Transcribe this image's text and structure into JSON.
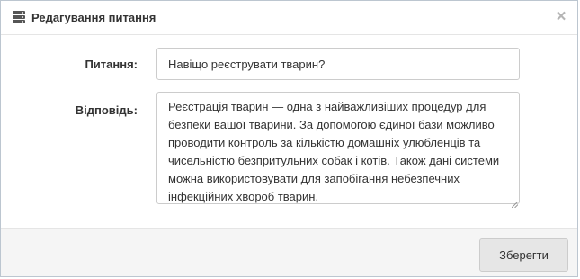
{
  "dialog": {
    "title": "Редагування питання",
    "title_icon": "server-icon",
    "close_icon": "close-icon",
    "close_label": "×"
  },
  "form": {
    "question_label": "Питання:",
    "question_value": "Навіщо реєструвати тварин?",
    "answer_label": "Відповідь:",
    "answer_value": "Реєстрація тварин — одна з найважливіших процедур для безпеки вашої тварини. За допомогою єдиної бази можливо проводити контроль за кількістю домашніх улюбленців та чисельністю безпритульних собак і котів. Також дані системи можна використовувати для запобігання небезпечних інфекційних хвороб тварин."
  },
  "footer": {
    "save_label": "Зберегти"
  },
  "colors": {
    "border": "#bcc6d0",
    "footer_bg": "#f5f5f5",
    "button_bg": "#e6e6e6",
    "text": "#333333"
  }
}
